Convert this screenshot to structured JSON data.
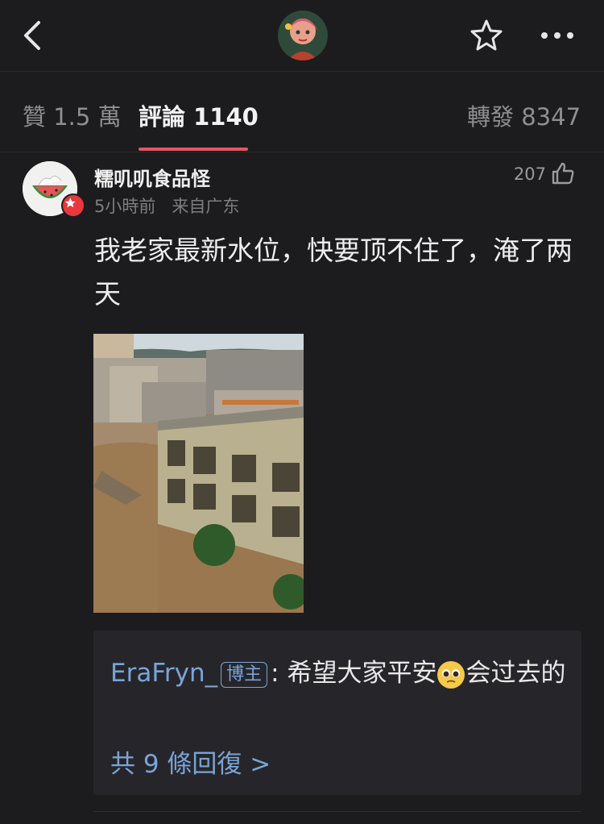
{
  "header": {
    "back_icon": "chevron-left-icon",
    "favorite_icon": "star-icon",
    "more_icon": "more-dots-icon"
  },
  "tabs": [
    {
      "label": "贊 1.5 萬"
    },
    {
      "label": "評論 1140"
    },
    {
      "label": "轉發 8347"
    }
  ],
  "accent_color": "#e85461",
  "comment": {
    "username": "糯叽叽食品怪",
    "time": "5小時前",
    "location": "来自广东",
    "likes": "207",
    "text": "我老家最新水位，快要顶不住了，淹了两天",
    "image_alt": "flooded town photo"
  },
  "reply": {
    "user": "EraFryn_",
    "tag": "博主",
    "colon": ":",
    "text_before": "希望大家平安",
    "text_after": "会过去的",
    "more": "共 9 條回復 >"
  }
}
